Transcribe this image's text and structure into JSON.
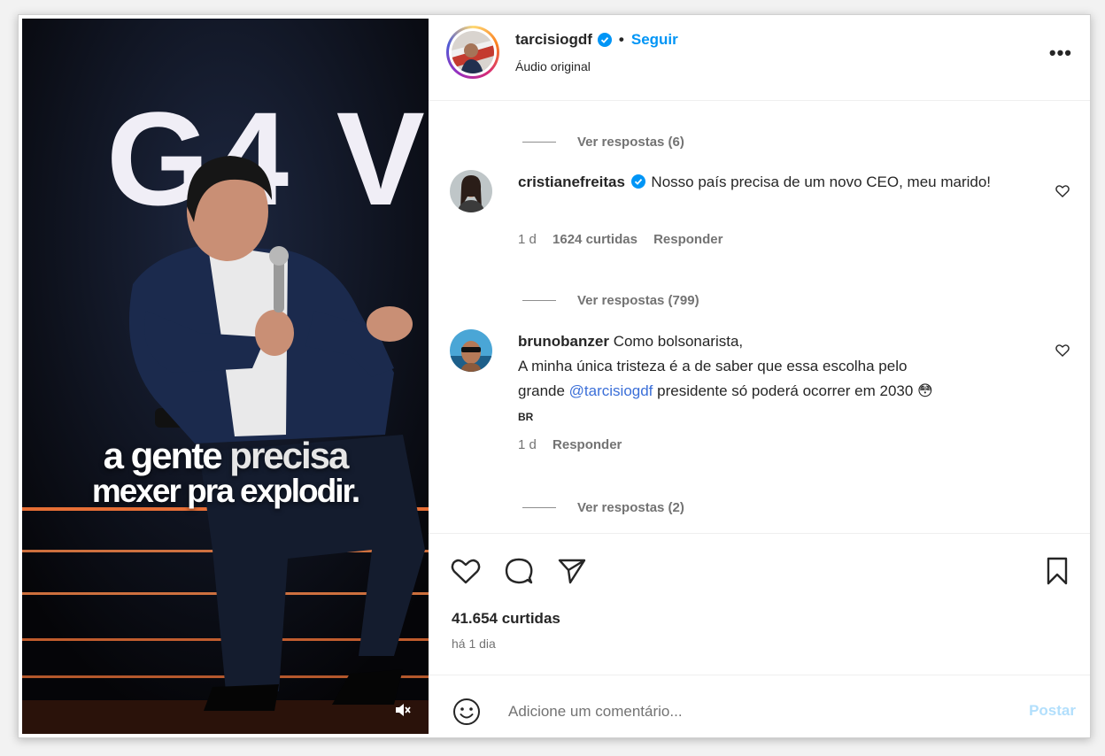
{
  "post": {
    "username": "tarcisiogdf",
    "separator": "•",
    "follow_label": "Seguir",
    "audio": "Áudio original",
    "more_label": "•••"
  },
  "video": {
    "overlay_line1_a": "a gente ",
    "overlay_line1_b": "precisa",
    "overlay_line2": "mexer pra explodir.",
    "backdrop_text": "G4 V"
  },
  "replies": [
    {
      "label": "Ver respostas (6)"
    },
    {
      "label": "Ver respostas (799)"
    },
    {
      "label": "Ver respostas (2)"
    }
  ],
  "comments": [
    {
      "username": "cristianefreitas",
      "text": "Nosso país precisa de um novo CEO, meu marido!",
      "age": "1 d",
      "likes": "1624 curtidas",
      "reply": "Responder"
    },
    {
      "username": "brunobanzer",
      "text_line1": "Como bolsonarista,",
      "text_line2": "A minha única tristeza é a de saber que essa escolha pelo",
      "text_line3_a": "grande ",
      "mention": "@tarcisiogdf",
      "text_line3_b": " presidente só poderá ocorrer em 2030 ",
      "emoji": "😳",
      "flag": "BR",
      "age": "1 d",
      "reply": "Responder"
    }
  ],
  "actions": {
    "likes": "41.654 curtidas",
    "time": "há 1 dia"
  },
  "composer": {
    "placeholder": "Adicione um comentário...",
    "post_label": "Postar"
  },
  "colors": {
    "accent": "#0095f6",
    "muted": "#737373",
    "text": "#262626"
  }
}
